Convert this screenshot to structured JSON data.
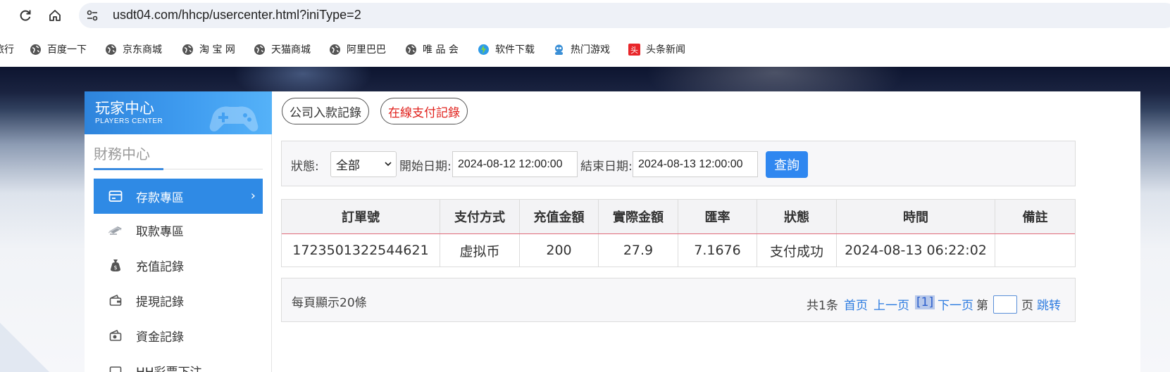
{
  "browser": {
    "url": "usdt04.com/hhcp/usercenter.html?iniType=2",
    "bookmarks": [
      "旅行",
      "百度一下",
      "京东商城",
      "淘 宝 网",
      "天猫商城",
      "阿里巴巴",
      "唯 品 会",
      "软件下载",
      "热门游戏",
      "头条新闻"
    ]
  },
  "sidebar": {
    "title": "玩家中心",
    "subtitle": "PLAYERS CENTER",
    "section": "財務中心",
    "items": [
      {
        "label": "存款專區",
        "icon": "card-icon",
        "active": true
      },
      {
        "label": "取款專區",
        "icon": "cash-icon",
        "active": false
      },
      {
        "label": "充值記錄",
        "icon": "money-bag-icon",
        "active": false
      },
      {
        "label": "提現記錄",
        "icon": "wallet-icon",
        "active": false
      },
      {
        "label": "資金記錄",
        "icon": "coins-icon",
        "active": false
      },
      {
        "label": "HH彩票下注",
        "icon": "ticket-icon",
        "active": false
      }
    ]
  },
  "tabs": [
    {
      "label": "公司入款記錄",
      "active": false
    },
    {
      "label": "在線支付記錄",
      "active": true
    }
  ],
  "filter": {
    "status_label": "狀態:",
    "status_value": "全部",
    "start_label": "開始日期:",
    "start_value": "2024-08-12 12:00:00",
    "end_label": "結束日期:",
    "end_value": "2024-08-13 12:00:00",
    "query_label": "查詢"
  },
  "table": {
    "headers": [
      "訂單號",
      "支付方式",
      "充值金額",
      "實際金額",
      "匯率",
      "狀態",
      "時間",
      "備註"
    ],
    "rows": [
      [
        "1723501322544621",
        "虚拟币",
        "200",
        "27.9",
        "7.1676",
        "支付成功",
        "2024-08-13 06:22:02",
        ""
      ]
    ]
  },
  "pager": {
    "per_page": "每頁顯示20條",
    "total": "共1条",
    "first": "首页",
    "prev": "上一页",
    "current": "[1]",
    "next": "下一页",
    "page_prefix": "第",
    "page_suffix": "页",
    "jump": "跳转"
  },
  "colors": {
    "accent": "#2f8ae5",
    "active_tab_text": "#e0211c",
    "link": "#2c7be0"
  }
}
